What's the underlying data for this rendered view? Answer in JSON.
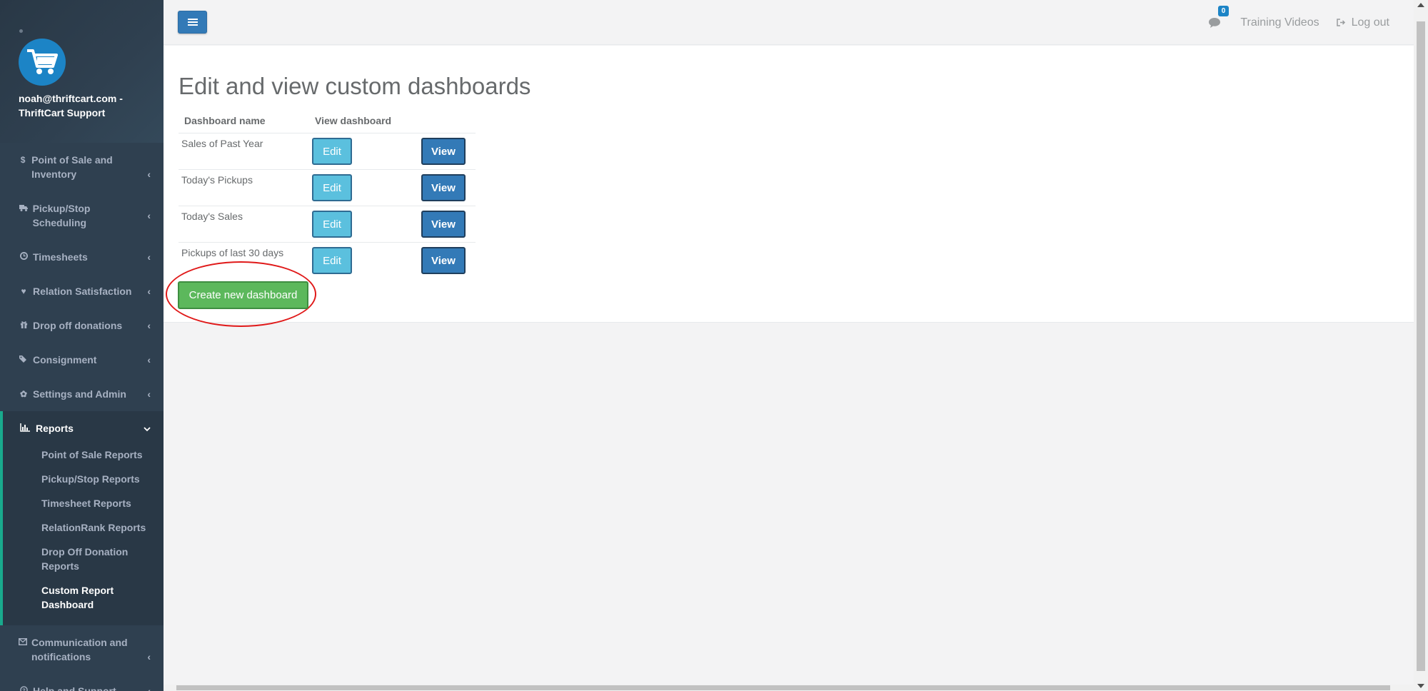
{
  "sidebar": {
    "user": "noah@thriftcart.com - ThriftCart Support",
    "items": [
      {
        "label": "Point of Sale and Inventory",
        "icon": "dollar-icon"
      },
      {
        "label": "Pickup/Stop Scheduling",
        "icon": "truck-icon"
      },
      {
        "label": "Timesheets",
        "icon": "clock-icon"
      },
      {
        "label": "Relation Satisfaction",
        "icon": "heart-icon"
      },
      {
        "label": "Drop off donations",
        "icon": "gift-icon"
      },
      {
        "label": "Consignment",
        "icon": "tags-icon"
      },
      {
        "label": "Settings and Admin",
        "icon": "gear-icon"
      }
    ],
    "reports": {
      "label": "Reports",
      "icon": "bar-chart-icon",
      "sub_items": [
        "Point of Sale Reports",
        "Pickup/Stop Reports",
        "Timesheet Reports",
        "RelationRank Reports",
        "Drop Off Donation Reports",
        "Custom Report Dashboard"
      ]
    },
    "bottom_items": [
      {
        "label": "Communication and notifications",
        "icon": "envelope-icon"
      },
      {
        "label": "Help and Support",
        "icon": "question-icon"
      }
    ]
  },
  "topbar": {
    "message_count": "0",
    "training_videos": "Training Videos",
    "logout": "Log out"
  },
  "main": {
    "title": "Edit and view custom dashboards",
    "table": {
      "headers": [
        "Dashboard name",
        "View dashboard"
      ],
      "rows": [
        {
          "name": "Sales of Past Year",
          "edit": "Edit",
          "view": "View"
        },
        {
          "name": "Today's Pickups",
          "edit": "Edit",
          "view": "View"
        },
        {
          "name": "Today's Sales",
          "edit": "Edit",
          "view": "View"
        },
        {
          "name": "Pickups of last 30 days",
          "edit": "Edit",
          "view": "View"
        }
      ]
    },
    "create_button": "Create new dashboard"
  },
  "colors": {
    "sidebar_bg": "#2f4050",
    "accent_green": "#19aa8d",
    "primary_blue": "#337ab7",
    "info_blue": "#5bc0de",
    "success_green": "#5cb85c",
    "highlight_red": "#e01919"
  }
}
